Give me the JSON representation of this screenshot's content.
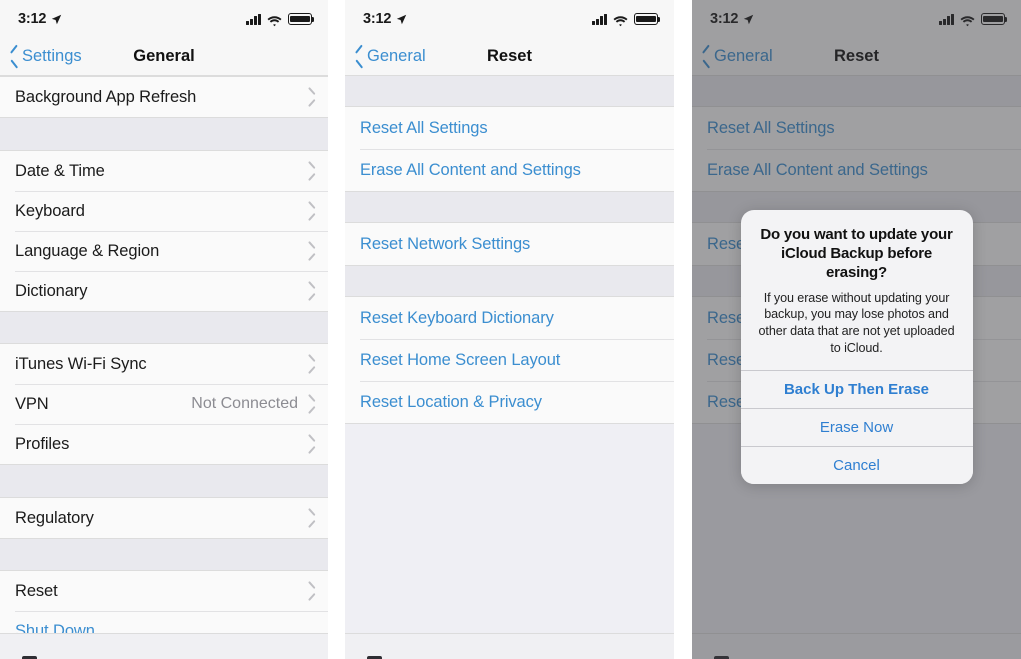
{
  "status_bar": {
    "time": "3:12",
    "location_icon": "location-arrow-icon",
    "signal_icon": "cellular-signal-icon",
    "wifi_icon": "wifi-icon",
    "battery_icon": "battery-full-icon"
  },
  "colors": {
    "accent_blue": "#3b8ed0",
    "alert_blue": "#2f7fd1",
    "list_bg": "#fafafa",
    "group_gap": "#e9e9ee",
    "screen_bg": "#efeff4",
    "chrome": "#f7f7f7",
    "dim_overlay": "#88888a"
  },
  "panel_general": {
    "nav": {
      "back_label": "Settings",
      "title": "General"
    },
    "groups": [
      {
        "rows": [
          {
            "label": "Background App Refresh",
            "value": "",
            "accessory": "chevron-right-icon",
            "style": "default"
          }
        ]
      },
      {
        "rows": [
          {
            "label": "Date & Time",
            "value": "",
            "accessory": "chevron-right-icon",
            "style": "default"
          },
          {
            "label": "Keyboard",
            "value": "",
            "accessory": "chevron-right-icon",
            "style": "default"
          },
          {
            "label": "Language & Region",
            "value": "",
            "accessory": "chevron-right-icon",
            "style": "default"
          },
          {
            "label": "Dictionary",
            "value": "",
            "accessory": "chevron-right-icon",
            "style": "default"
          }
        ]
      },
      {
        "rows": [
          {
            "label": "iTunes Wi-Fi Sync",
            "value": "",
            "accessory": "chevron-right-icon",
            "style": "default"
          },
          {
            "label": "VPN",
            "value": "Not Connected",
            "accessory": "chevron-right-icon",
            "style": "default"
          },
          {
            "label": "Profiles",
            "value": "",
            "accessory": "chevron-right-icon",
            "style": "default"
          }
        ]
      },
      {
        "rows": [
          {
            "label": "Regulatory",
            "value": "",
            "accessory": "chevron-right-icon",
            "style": "default"
          }
        ]
      },
      {
        "rows": [
          {
            "label": "Reset",
            "value": "",
            "accessory": "chevron-right-icon",
            "style": "default"
          },
          {
            "label": "Shut Down",
            "value": "",
            "accessory": "",
            "style": "blue"
          }
        ]
      }
    ]
  },
  "panel_reset": {
    "nav": {
      "back_label": "General",
      "title": "Reset"
    },
    "groups": [
      {
        "items": [
          "Reset All Settings",
          "Erase All Content and Settings"
        ]
      },
      {
        "items": [
          "Reset Network Settings"
        ]
      },
      {
        "items": [
          "Reset Keyboard Dictionary",
          "Reset Home Screen Layout",
          "Reset Location & Privacy"
        ]
      }
    ]
  },
  "panel_alert": {
    "nav": {
      "back_label": "General",
      "title": "Reset"
    },
    "groups": [
      {
        "items": [
          "Reset All Settings",
          "Erase All Content and Settings"
        ]
      },
      {
        "items": [
          "Reset Network Settings"
        ]
      },
      {
        "items": [
          "Reset Keyboard Dictionary",
          "Reset Home Screen Layout",
          "Reset Location & Privacy"
        ]
      }
    ],
    "alert": {
      "title": "Do you want to update your iCloud Backup before erasing?",
      "message": "If you erase without updating your backup, you may lose photos and other data that are not yet uploaded to iCloud.",
      "buttons": [
        {
          "label": "Back Up Then Erase",
          "emphasis": "bold"
        },
        {
          "label": "Erase Now",
          "emphasis": "normal"
        },
        {
          "label": "Cancel",
          "emphasis": "normal"
        }
      ]
    }
  }
}
